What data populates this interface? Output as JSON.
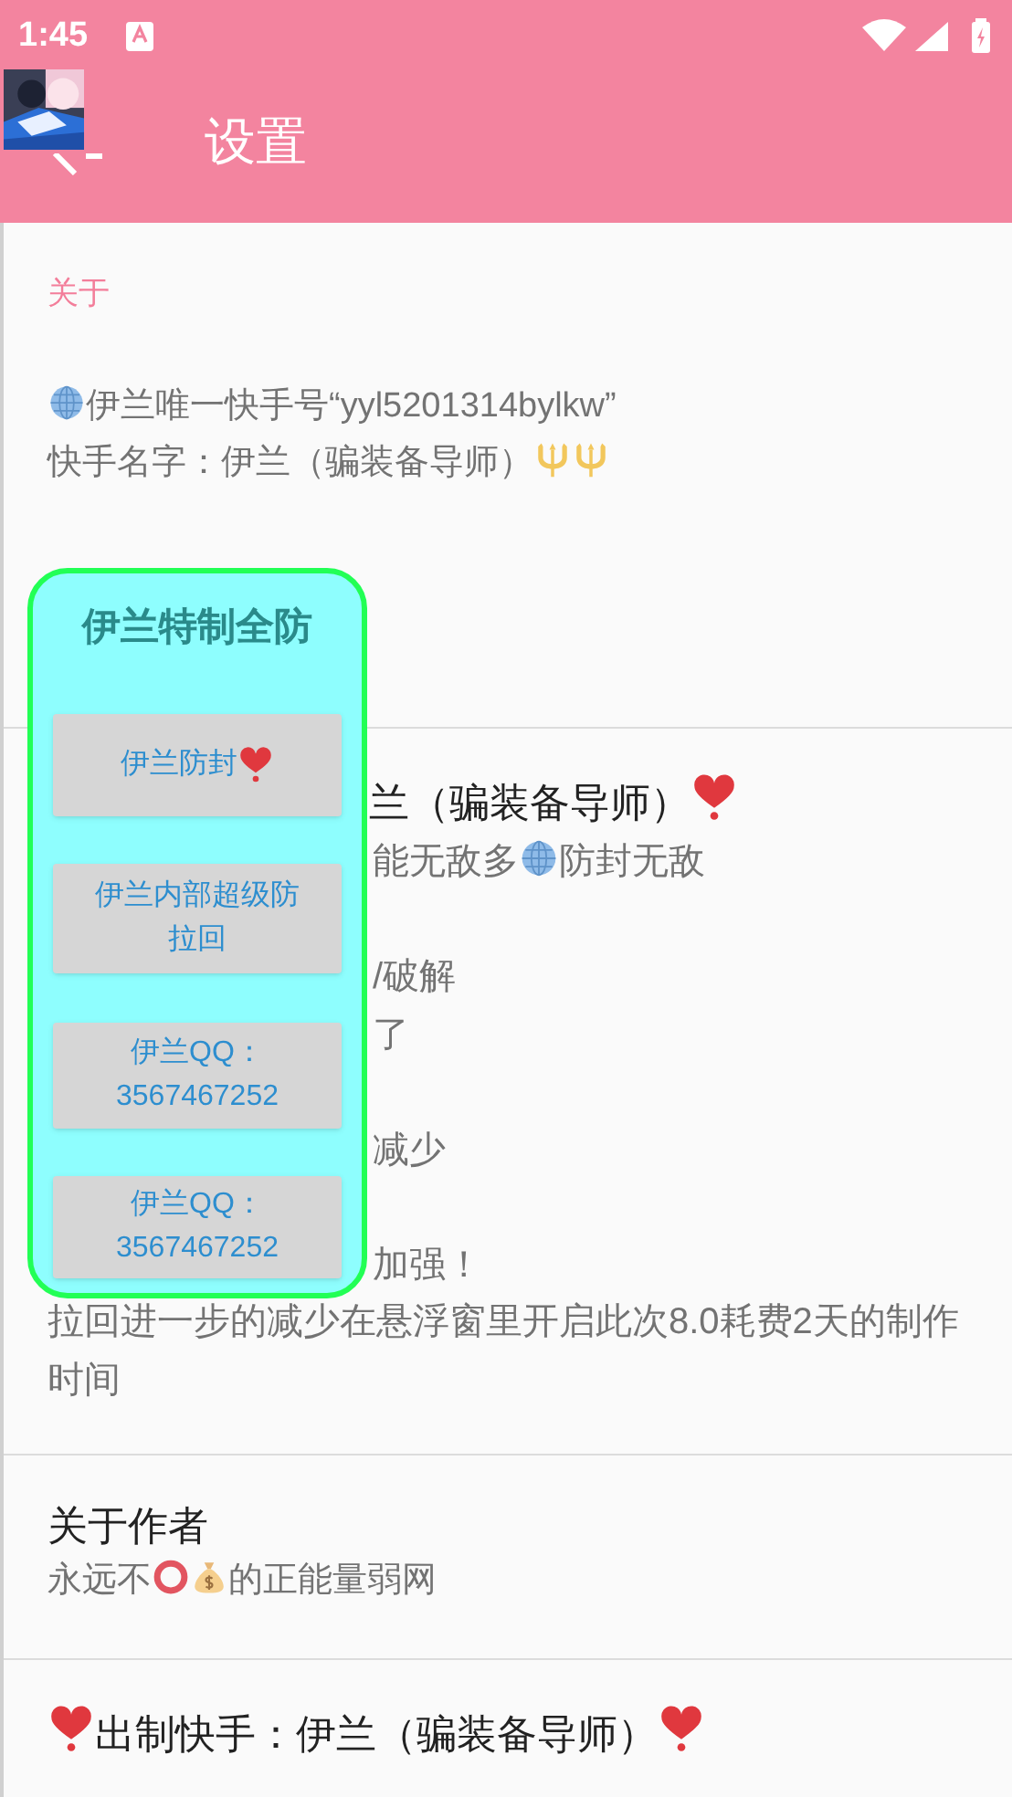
{
  "status_bar": {
    "time": "1:45"
  },
  "toolbar": {
    "title": "设置"
  },
  "section_header": "关于",
  "about_lines": [
    [
      {
        "kind": "globe"
      },
      {
        "kind": "text",
        "text": "伊兰唯一快手号“yyl5201314bylkw”"
      }
    ],
    [
      {
        "kind": "text",
        "text": "快手名字：伊兰（骗装备导师）"
      },
      {
        "kind": "trident"
      },
      {
        "kind": "trident"
      }
    ]
  ],
  "covered_item": {
    "title": [
      {
        "kind": "text",
        "text": "兰（骗装备导师）"
      },
      {
        "kind": "heart"
      }
    ],
    "fragments": [
      [
        {
          "kind": "text",
          "text": "能无敌多"
        },
        {
          "kind": "globe"
        },
        {
          "kind": "text",
          "text": "防封无敌"
        }
      ],
      [
        {
          "kind": "text",
          "text": "/破解"
        }
      ],
      [
        {
          "kind": "text",
          "text": "了"
        }
      ],
      [
        {
          "kind": "text",
          "text": "减少"
        }
      ],
      [
        {
          "kind": "text",
          "text": "加强！"
        }
      ]
    ],
    "summary": "拉回进一步的减少在悬浮窗里开启此次8.0耗费2天的制作时间"
  },
  "author_item": {
    "title": "关于作者",
    "summary": [
      {
        "kind": "text",
        "text": "永远不"
      },
      {
        "kind": "ring"
      },
      {
        "kind": "moneybag"
      },
      {
        "kind": "text",
        "text": "的正能量弱网"
      }
    ]
  },
  "maker_item": {
    "title": [
      {
        "kind": "heart"
      },
      {
        "kind": "text",
        "text": "出制快手：伊兰（骗装备导师）"
      },
      {
        "kind": "heart"
      }
    ]
  },
  "floating_panel": {
    "title": "伊兰特制全防",
    "buttons": [
      [
        {
          "kind": "text",
          "text": "伊兰防封"
        },
        {
          "kind": "heart"
        }
      ],
      [
        {
          "kind": "text",
          "text": "伊兰内部超级防拉回"
        }
      ],
      [
        {
          "kind": "text",
          "text": "伊兰QQ：3567467252"
        }
      ],
      [
        {
          "kind": "text",
          "text": "伊兰QQ：3567467252"
        }
      ]
    ]
  }
}
